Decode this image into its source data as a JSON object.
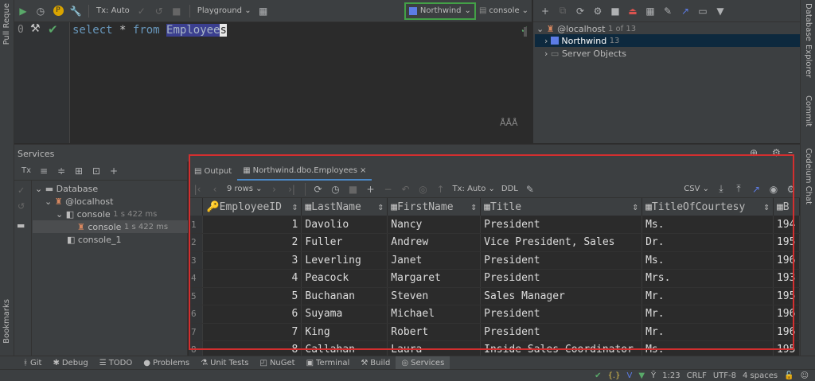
{
  "left_strip": {
    "top_label": "Pull Reque",
    "bottom_label": "Bookmarks"
  },
  "right_strip": {
    "items": [
      "Database",
      "Explorer",
      "Commit",
      "Codeium Chat"
    ]
  },
  "editor_toolbar": {
    "tx_label": "Tx: Auto",
    "playground_label": "Playground",
    "datasource_label": "Northwind",
    "session_label": "console"
  },
  "editor": {
    "line_number": "0",
    "code": {
      "kw1": "select",
      "star": "*",
      "kw2": "from",
      "table": "Employee",
      "cursor_char": "s"
    }
  },
  "db_tree": {
    "host": "@localhost",
    "host_count": "1 of 13",
    "db": "Northwind",
    "db_count": "13",
    "server_objects": "Server Objects"
  },
  "services": {
    "title": "Services",
    "tree": {
      "database": "Database",
      "host": "@localhost",
      "console": "console",
      "console_time": "1 s 422 ms",
      "console_child": "console",
      "console_child_time": "1 s 422 ms",
      "console1": "console_1"
    }
  },
  "results": {
    "tabs": [
      "Output",
      "Northwind.dbo.Employees"
    ],
    "rows_label": "9 rows",
    "tx_label": "Tx: Auto",
    "ddl_label": "DDL",
    "format_label": "CSV",
    "columns": [
      "EmployeeID",
      "LastName",
      "FirstName",
      "Title",
      "TitleOfCourtesy",
      "B"
    ],
    "rows": [
      [
        "1",
        "1",
        "Davolio",
        "Nancy",
        "President",
        "Ms.",
        "194"
      ],
      [
        "2",
        "2",
        "Fuller",
        "Andrew",
        "Vice President, Sales",
        "Dr.",
        "195"
      ],
      [
        "3",
        "3",
        "Leverling",
        "Janet",
        "President",
        "Ms.",
        "196"
      ],
      [
        "4",
        "4",
        "Peacock",
        "Margaret",
        "President",
        "Mrs.",
        "193"
      ],
      [
        "5",
        "5",
        "Buchanan",
        "Steven",
        "Sales Manager",
        "Mr.",
        "195"
      ],
      [
        "6",
        "6",
        "Suyama",
        "Michael",
        "President",
        "Mr.",
        "196"
      ],
      [
        "7",
        "7",
        "King",
        "Robert",
        "President",
        "Mr.",
        "196"
      ],
      [
        "8",
        "8",
        "Callahan",
        "Laura",
        "Inside Sales Coordinator",
        "Ms.",
        "195"
      ]
    ]
  },
  "tool_tabs": [
    "Git",
    "Debug",
    "TODO",
    "Problems",
    "Unit Tests",
    "NuGet",
    "Terminal",
    "Build",
    "Services"
  ],
  "status": {
    "position": "1:23",
    "line_sep": "CRLF",
    "encoding": "UTF-8",
    "indent": "4 spaces"
  },
  "colors": {
    "keyword": "#6897bb",
    "accent_green": "#4caf50",
    "highlight_red": "#d32f2f",
    "table_highlight": "#3b3f8f"
  }
}
